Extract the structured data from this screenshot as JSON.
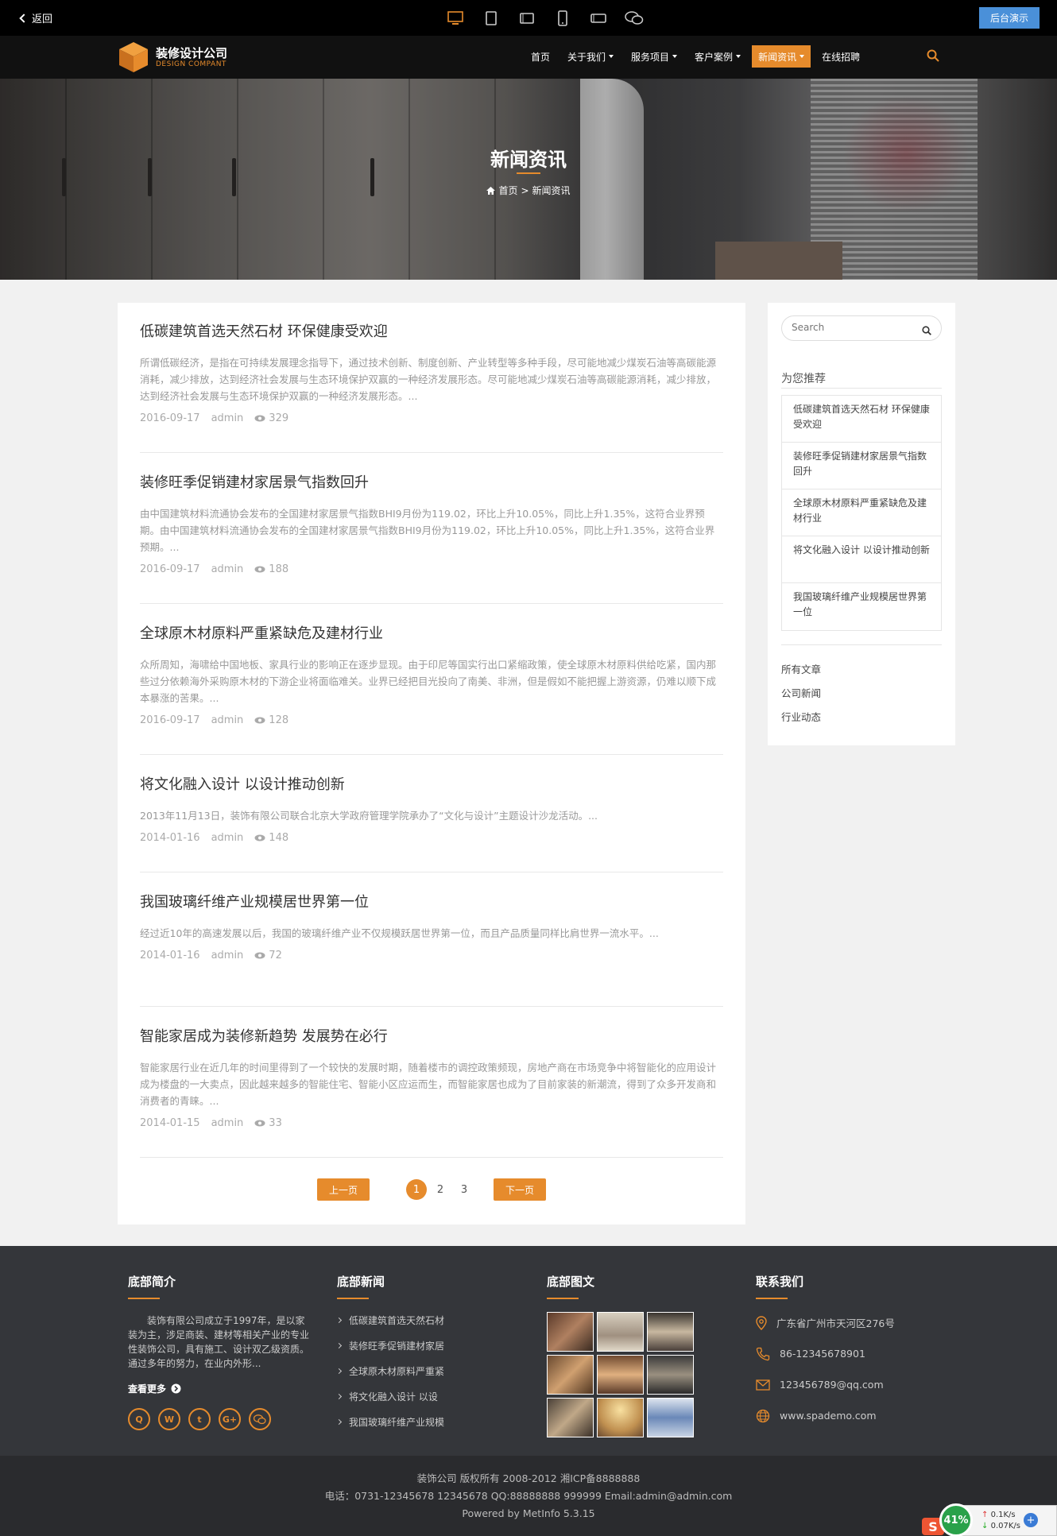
{
  "topbar": {
    "back_label": "返回",
    "admin_label": "后台演示",
    "devices": [
      "desktop-icon",
      "tablet-icon",
      "tablet-landscape-icon",
      "phone-icon",
      "phone-landscape-icon",
      "wechat-icon"
    ]
  },
  "header": {
    "logo_cn": "装修设计公司",
    "logo_en": "DESIGN COMPANT",
    "nav": [
      {
        "label": "首页",
        "dropdown": false,
        "active": false
      },
      {
        "label": "关于我们",
        "dropdown": true,
        "active": false
      },
      {
        "label": "服务项目",
        "dropdown": true,
        "active": false
      },
      {
        "label": "客户案例",
        "dropdown": true,
        "active": false
      },
      {
        "label": "新闻资讯",
        "dropdown": true,
        "active": true
      },
      {
        "label": "在线招聘",
        "dropdown": false,
        "active": false
      }
    ]
  },
  "banner": {
    "title": "新闻资讯",
    "crumb_home": "首页",
    "crumb_sep": ">",
    "crumb_current": "新闻资讯"
  },
  "articles": [
    {
      "title": "低碳建筑首选天然石材 环保健康受欢迎",
      "desc": "所谓低碳经济，是指在可持续发展理念指导下，通过技术创新、制度创新、产业转型等多种手段，尽可能地减少煤炭石油等高碳能源消耗，减少排放，达到经济社会发展与生态环境保护双赢的一种经济发展形态。尽可能地减少煤炭石油等高碳能源消耗，减少排放，达到经济社会发展与生态环境保护双赢的一种经济发展形态。...",
      "date": "2016-09-17",
      "author": "admin",
      "views": "329"
    },
    {
      "title": "装修旺季促销建材家居景气指数回升",
      "desc": "由中国建筑材料流通协会发布的全国建材家居景气指数BHI9月份为119.02，环比上升10.05%，同比上升1.35%，这符合业界预期。由中国建筑材料流通协会发布的全国建材家居景气指数BHI9月份为119.02，环比上升10.05%，同比上升1.35%，这符合业界预期。...",
      "date": "2016-09-17",
      "author": "admin",
      "views": "188"
    },
    {
      "title": "全球原木材原料严重紧缺危及建材行业",
      "desc": "众所周知，海啸给中国地板、家具行业的影响正在逐步显现。由于印尼等国实行出口紧缩政策，使全球原木材原料供给吃紧，国内那些过分依赖海外采购原木材的下游企业将面临难关。业界已经把目光投向了南美、非洲，但是假如不能把握上游资源，仍难以顺下成本暴涨的苦果。...",
      "date": "2016-09-17",
      "author": "admin",
      "views": "128"
    },
    {
      "title": "将文化融入设计 以设计推动创新",
      "desc": "2013年11月13日，装饰有限公司联合北京大学政府管理学院承办了“文化与设计”主题设计沙龙活动。...",
      "date": "2014-01-16",
      "author": "admin",
      "views": "148"
    },
    {
      "title": "我国玻璃纤维产业规模居世界第一位",
      "desc": "经过近10年的高速发展以后，我国的玻璃纤维产业不仅规模跃居世界第一位，而且产品质量同样比肩世界一流水平。...",
      "date": "2014-01-16",
      "author": "admin",
      "views": "72"
    },
    {
      "title": "智能家居成为装修新趋势 发展势在必行",
      "desc": "智能家居行业在近几年的时间里得到了一个较快的发展时期，随着楼市的调控政策频现，房地产商在市场竞争中将智能化的应用设计成为楼盘的一大卖点，因此越来越多的智能住宅、智能小区应运而生，而智能家居也成为了目前家装的新潮流，得到了众多开发商和消费者的青睐。...",
      "date": "2014-01-15",
      "author": "admin",
      "views": "33"
    }
  ],
  "pager": {
    "prev": "上一页",
    "next": "下一页",
    "pages": [
      "1",
      "2",
      "3"
    ],
    "current": "1"
  },
  "sidebar": {
    "search_placeholder": "Search",
    "rec_title": "为您推荐",
    "recommended": [
      "低碳建筑首选天然石材 环保健康受欢迎",
      "装修旺季促销建材家居景气指数回升",
      "全球原木材原料严重紧缺危及建材行业",
      "将文化融入设计 以设计推动创新",
      "我国玻璃纤维产业规模居世界第一位"
    ],
    "categories": [
      "所有文章",
      "公司新闻",
      "行业动态"
    ]
  },
  "footer": {
    "intro_title": "底部简介",
    "intro_text": "装饰有限公司成立于1997年，是以家装为主，涉足商装、建材等相关产业的专业性装饰公司，具有施工、设计双乙级资质。通过多年的努力，在业内外形...",
    "more": "查看更多",
    "social": [
      "qq-icon",
      "weibo-icon",
      "twitter-icon",
      "google-plus-icon",
      "wechat-icon"
    ],
    "news_title": "底部新闻",
    "news": [
      "低碳建筑首选天然石材",
      "装修旺季促销建材家居",
      "全球原木材原料严重紧",
      "将文化融入设计 以设",
      "我国玻璃纤维产业规模"
    ],
    "gallery_title": "底部图文",
    "contact_title": "联系我们",
    "contact": [
      {
        "icon": "location-icon",
        "text": "广东省广州市天河区276号"
      },
      {
        "icon": "phone-icon",
        "text": "86-12345678901"
      },
      {
        "icon": "mail-icon",
        "text": "123456789@qq.com"
      },
      {
        "icon": "globe-icon",
        "text": "www.spademo.com"
      }
    ],
    "copy1": "装饰公司 版权所有 2008-2012 湘ICP备8888888",
    "copy2": "电话：0731-12345678 12345678 QQ:88888888 999999 Email:admin@admin.com",
    "copy3": "Powered by MetInfo 5.3.15"
  },
  "widget": {
    "percent": "41%",
    "up": "0.1K/s",
    "down": "0.07K/s"
  },
  "colors": {
    "accent": "#e68b2c",
    "admin_btn": "#4a90d9",
    "footer_bg": "#34363a"
  }
}
